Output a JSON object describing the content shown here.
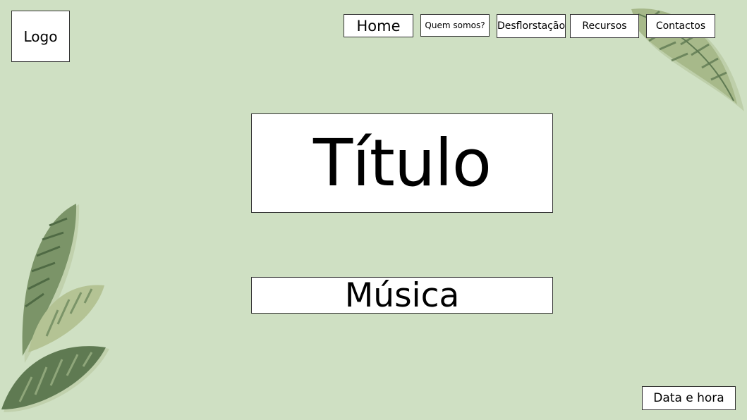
{
  "header": {
    "logo_label": "Logo",
    "nav": [
      {
        "label": "Home"
      },
      {
        "label": "Quem somos?"
      },
      {
        "label": "Desflorstação"
      },
      {
        "label": "Recursos"
      },
      {
        "label": "Contactos"
      }
    ]
  },
  "main": {
    "title": "Título",
    "subtitle": "Música"
  },
  "footer": {
    "datetime_label": "Data e hora"
  },
  "decor": {
    "background_color": "#cfe0c3",
    "leaf_dark": "#5f7a52",
    "leaf_light": "#a7b98a",
    "leaf_icon": "leaf-icon"
  }
}
